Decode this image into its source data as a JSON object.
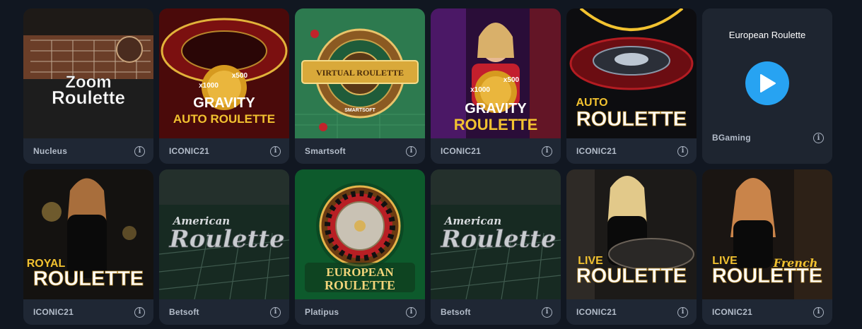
{
  "games": [
    {
      "art_text": [
        "Zoom",
        "Roulette"
      ],
      "provider": "Nucleus",
      "info_icon": "info-icon"
    },
    {
      "art_text": [
        "x1000",
        "x500",
        "GRAVITY",
        "AUTO ROULETTE"
      ],
      "provider": "ICONIC21",
      "info_icon": "info-icon"
    },
    {
      "art_text": [
        "VIRTUAL ROULETTE",
        "SMARTSOFT"
      ],
      "provider": "Smartsoft",
      "info_icon": "info-icon"
    },
    {
      "art_text": [
        "x1000",
        "x500",
        "GRAVITY",
        "ROULETTE"
      ],
      "provider": "ICONIC21",
      "info_icon": "info-icon"
    },
    {
      "art_text": [
        "AUTO",
        "ROULETTE"
      ],
      "provider": "ICONIC21",
      "info_icon": "info-icon"
    },
    {
      "hover_title": "European Roulette",
      "provider": "BGaming",
      "info_icon": "info-icon",
      "play_icon": "play-icon"
    },
    {
      "art_text": [
        "ROYAL",
        "ROULETTE"
      ],
      "provider": "ICONIC21",
      "info_icon": "info-icon"
    },
    {
      "art_text": [
        "American",
        "Roulette"
      ],
      "provider": "Betsoft",
      "info_icon": "info-icon"
    },
    {
      "art_text": [
        "EUROPEAN",
        "ROULETTE"
      ],
      "provider": "Platipus",
      "info_icon": "info-icon"
    },
    {
      "art_text": [
        "American",
        "Roulette"
      ],
      "provider": "Betsoft",
      "info_icon": "info-icon"
    },
    {
      "art_text": [
        "LIVE",
        "ROULETTE"
      ],
      "provider": "ICONIC21",
      "info_icon": "info-icon"
    },
    {
      "art_text": [
        "LIVE",
        "French",
        "ROULETTE"
      ],
      "provider": "ICONIC21",
      "info_icon": "info-icon"
    }
  ],
  "colors": {
    "page_bg": "#111721",
    "card_footer": "#1f2734",
    "play_button": "#27a3f2",
    "provider_text": "#b4bdca"
  }
}
